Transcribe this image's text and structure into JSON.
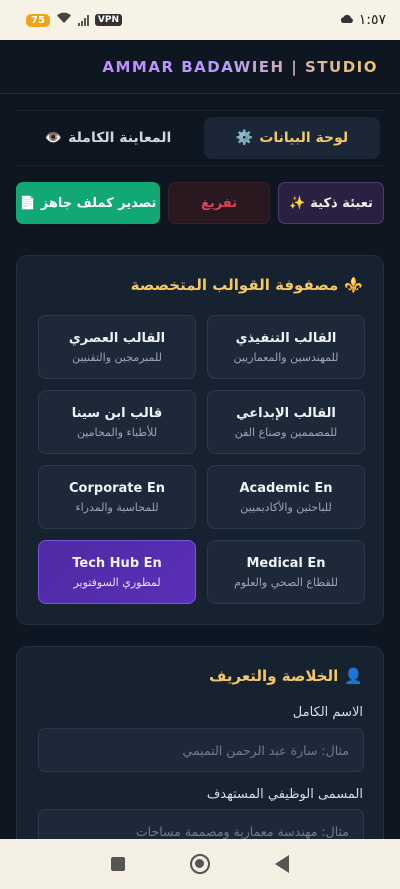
{
  "status_bar": {
    "time": "١:٥٧",
    "battery": "75",
    "vpn": "VPN"
  },
  "header": {
    "brand": "AMMAR BADAWIEH | STUDIO"
  },
  "tabs": [
    {
      "icon": "eye-icon",
      "glyph": "👁️",
      "label": "المعاينة الكاملة",
      "active": false
    },
    {
      "icon": "gear-icon",
      "glyph": "⚙️",
      "label": "لوحة البيانات",
      "active": true
    }
  ],
  "actions": {
    "export": {
      "icon": "document-icon",
      "glyph": "📄",
      "label": "تصدير كملف جاهز"
    },
    "clear": {
      "label": "تفريغ"
    },
    "fill": {
      "icon": "sparkles-icon",
      "glyph": "✨",
      "label": "تعبئة ذكية"
    }
  },
  "templates_panel": {
    "icon": "fleur-de-lis-icon",
    "glyph": "⚜️",
    "title": "مصفوفة القوالب المتخصصة",
    "cards": [
      {
        "title": "القالب التنفيذي",
        "subtitle": "للمهندسين والمعماريين",
        "selected": false
      },
      {
        "title": "القالب العصري",
        "subtitle": "للمبرمجين والتقنيين",
        "selected": false
      },
      {
        "title": "القالب الإبداعي",
        "subtitle": "للمصممين وصناع الفن",
        "selected": false
      },
      {
        "title": "قالب ابن سينا",
        "subtitle": "للأطباء والمحامين",
        "selected": false
      },
      {
        "title": "Academic En",
        "subtitle": "للباحثين والأكاديميين",
        "selected": false
      },
      {
        "title": "Corporate En",
        "subtitle": "للمحاسبة والمدراء",
        "selected": false
      },
      {
        "title": "Medical En",
        "subtitle": "للقطاع الصحي والعلوم",
        "selected": false
      },
      {
        "title": "Tech Hub En",
        "subtitle": "لمطوري السوفتوير",
        "selected": true
      }
    ]
  },
  "summary_panel": {
    "icon": "person-icon",
    "glyph": "👤",
    "title": "الخلاصة والتعريف",
    "fields": [
      {
        "label": "الاسم الكامل",
        "value": "",
        "placeholder": "مثال: سارة عبد الرحمن التميمي"
      },
      {
        "label": "المسمى الوظيفي المستهدف",
        "value": "",
        "placeholder": "مثال: مهندسة معمارية ومصممة مساحات"
      }
    ]
  },
  "colors": {
    "accent_gold": "#f2c765",
    "selected_purple": "#5a2fb8",
    "export_green": "#12a873",
    "clear_red": "#e2435b"
  }
}
